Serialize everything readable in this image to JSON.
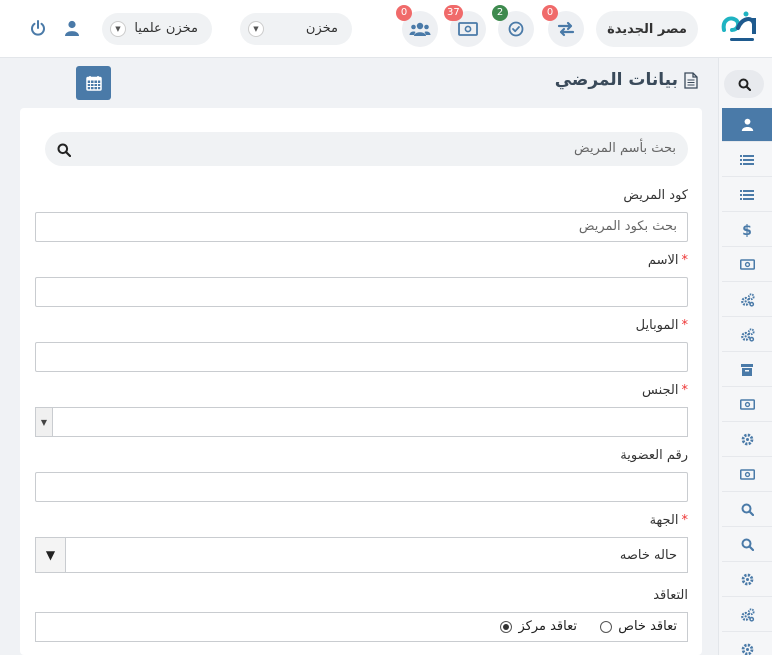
{
  "header": {
    "branch_label": "مصر الجديدة",
    "transfers_badge": "0",
    "approvals_badge": "2",
    "cash_badge": "37",
    "users_badge": "0",
    "store_select_value": "مخزن",
    "scientific_store_select_value": "مخزن علميا"
  },
  "sidebar": {
    "items": [
      "user",
      "list",
      "list",
      "dollar",
      "money",
      "gears",
      "gears",
      "archive",
      "money",
      "gear",
      "money",
      "search",
      "search",
      "gear",
      "gears",
      "gear"
    ]
  },
  "page": {
    "title": "بيانات المرضي"
  },
  "form": {
    "search_placeholder": "بحث بأسم المريض",
    "patient_code_label": "كود المريض",
    "patient_code_placeholder": "بحث بكود المريض",
    "name_label": "الاسم",
    "mobile_label": "الموبايل",
    "gender_label": "الجنس",
    "membership_label": "رقم العضوية",
    "entity_label": "الجهة",
    "entity_value": "حاله خاصه",
    "contract_label": "التعاقد",
    "contract_options": [
      "تعاقد خاص",
      "تعاقد مركز"
    ],
    "contract_selected_index": 1,
    "required_mark": "*"
  },
  "colors": {
    "accent": "#4a7aa8",
    "badge_red": "#f06a6a",
    "badge_green": "#3e8a4e",
    "logo_teal": "#1fb3c2"
  }
}
